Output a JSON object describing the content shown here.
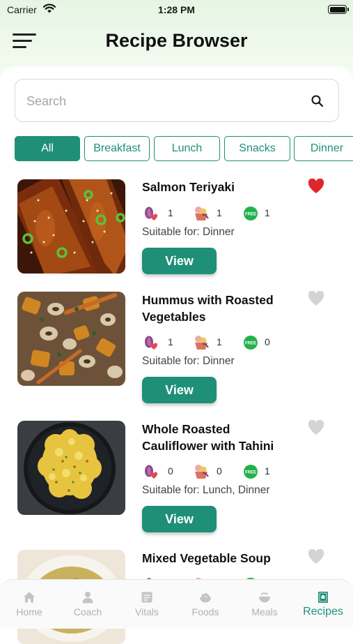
{
  "status_bar": {
    "carrier": "Carrier",
    "time": "1:28 PM"
  },
  "header": {
    "title": "Recipe Browser",
    "menu_icon": "hamburger-menu-icon"
  },
  "search": {
    "placeholder": "Search",
    "value": "",
    "icon": "search-icon"
  },
  "filters": [
    {
      "label": "All",
      "active": true
    },
    {
      "label": "Breakfast",
      "active": false
    },
    {
      "label": "Lunch",
      "active": false
    },
    {
      "label": "Snacks",
      "active": false
    },
    {
      "label": "Dinner",
      "active": false
    }
  ],
  "recipes": [
    {
      "title": "Salmon Teriyaki",
      "favorite": true,
      "stat1": "1",
      "stat2": "1",
      "free": "1",
      "suitable": "Suitable for: Dinner",
      "view_label": "View"
    },
    {
      "title": "Hummus with Roasted Vegetables",
      "favorite": false,
      "stat1": "1",
      "stat2": "1",
      "free": "0",
      "suitable": "Suitable for: Dinner",
      "view_label": "View"
    },
    {
      "title": "Whole Roasted Cauliflower with Tahini",
      "favorite": false,
      "stat1": "0",
      "stat2": "0",
      "free": "1",
      "suitable": "Suitable for: Lunch, Dinner",
      "view_label": "View"
    },
    {
      "title": "Mixed Vegetable Soup",
      "favorite": false
    }
  ],
  "free_badge": "FREE",
  "tabs": [
    {
      "label": "Home",
      "icon": "home-icon",
      "active": false
    },
    {
      "label": "Coach",
      "icon": "person-icon",
      "active": false
    },
    {
      "label": "Vitals",
      "icon": "vitals-icon",
      "active": false
    },
    {
      "label": "Foods",
      "icon": "bowl-icon",
      "active": false
    },
    {
      "label": "Meals",
      "icon": "meal-icon",
      "active": false
    },
    {
      "label": "Recipes",
      "icon": "recipe-book-icon",
      "active": true
    }
  ],
  "colors": {
    "accent": "#1f8f77",
    "heart_active": "#e0262d",
    "heart_inactive": "#d4d4d4",
    "free_badge": "#22b14c",
    "tab_inactive": "#b0b0b0"
  }
}
